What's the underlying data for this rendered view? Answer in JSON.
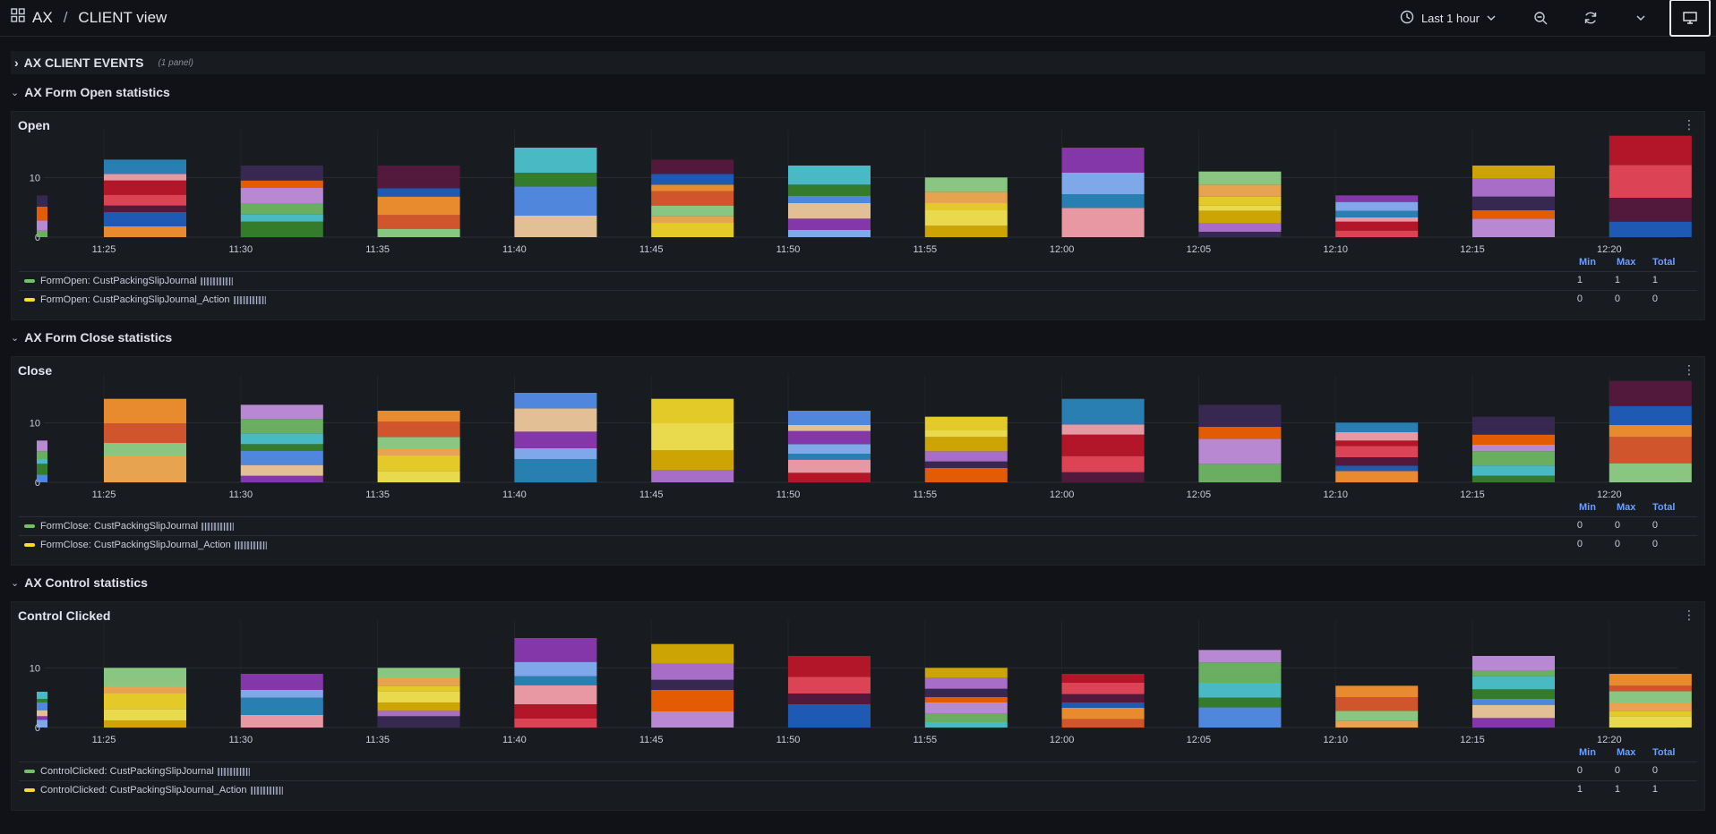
{
  "header": {
    "breadcrumb_home": "AX",
    "breadcrumb_sep": "/",
    "dashboard_title": "CLIENT view",
    "time_range": "Last 1 hour"
  },
  "rows": {
    "client_events": {
      "title": "AX CLIENT EVENTS",
      "note": "(1 panel)"
    },
    "form_open": {
      "title": "AX Form Open statistics"
    },
    "form_close": {
      "title": "AX Form Close statistics"
    },
    "control": {
      "title": "AX Control statistics"
    }
  },
  "legend_headers": {
    "min": "Min",
    "max": "Max",
    "total": "Total"
  },
  "colors": {
    "series_green": "#73bf69",
    "series_yellow": "#fade2a",
    "accent_blue": "#6e9fff"
  },
  "chart_data": [
    {
      "type": "bar",
      "title": "Open",
      "x_ticks": [
        "11:25",
        "11:30",
        "11:35",
        "11:40",
        "11:45",
        "11:50",
        "11:55",
        "12:00",
        "12:05",
        "12:10",
        "12:15",
        "12:20"
      ],
      "y_ticks": [
        0,
        10
      ],
      "ylim": [
        0,
        18
      ],
      "stacked": true,
      "stack_totals": [
        7,
        13,
        12,
        12,
        15,
        13,
        12,
        10,
        15,
        11,
        7,
        12,
        17
      ],
      "series": [
        {
          "name": "FormOpen: CustPackingSlipJournal",
          "min": "1",
          "max": "1",
          "total": "1"
        },
        {
          "name": "FormOpen: CustPackingSlipJournal_Action",
          "min": "0",
          "max": "0",
          "total": "0"
        }
      ]
    },
    {
      "type": "bar",
      "title": "Close",
      "x_ticks": [
        "11:25",
        "11:30",
        "11:35",
        "11:40",
        "11:45",
        "11:50",
        "11:55",
        "12:00",
        "12:05",
        "12:10",
        "12:15",
        "12:20"
      ],
      "y_ticks": [
        0,
        10
      ],
      "ylim": [
        0,
        18
      ],
      "stacked": true,
      "stack_totals": [
        7,
        14,
        13,
        12,
        15,
        14,
        12,
        11,
        14,
        13,
        10,
        11,
        17
      ],
      "series": [
        {
          "name": "FormClose: CustPackingSlipJournal",
          "min": "0",
          "max": "0",
          "total": "0"
        },
        {
          "name": "FormClose: CustPackingSlipJournal_Action",
          "min": "0",
          "max": "0",
          "total": "0"
        }
      ]
    },
    {
      "type": "bar",
      "title": "Control Clicked",
      "x_ticks": [
        "11:25",
        "11:30",
        "11:35",
        "11:40",
        "11:45",
        "11:50",
        "11:55",
        "12:00",
        "12:05",
        "12:10",
        "12:15",
        "12:20"
      ],
      "y_ticks": [
        0,
        10
      ],
      "ylim": [
        0,
        18
      ],
      "stacked": true,
      "stack_totals": [
        6,
        10,
        9,
        10,
        15,
        14,
        12,
        10,
        9,
        13,
        7,
        12,
        9
      ],
      "series": [
        {
          "name": "ControlClicked: CustPackingSlipJournal",
          "min": "0",
          "max": "0",
          "total": "0"
        },
        {
          "name": "ControlClicked: CustPackingSlipJournal_Action",
          "min": "1",
          "max": "1",
          "total": "1"
        }
      ]
    }
  ]
}
